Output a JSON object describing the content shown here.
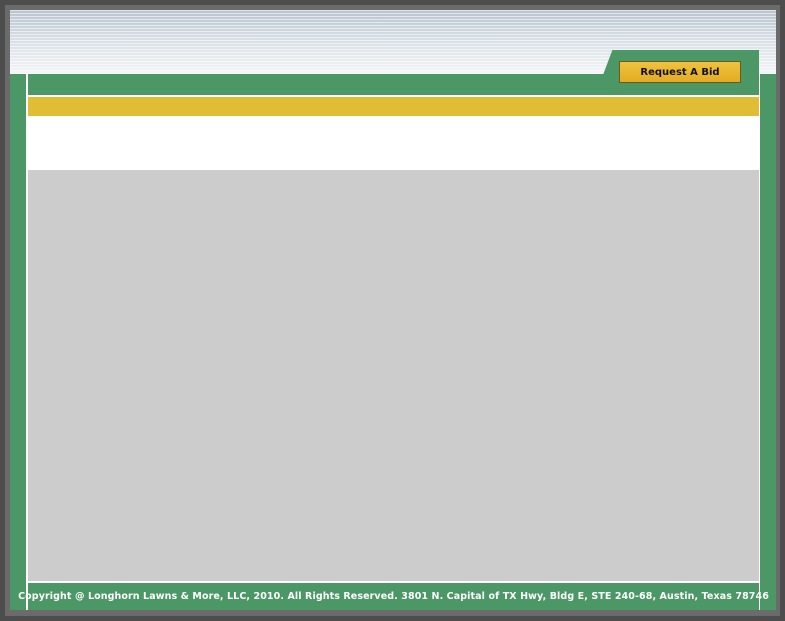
{
  "header": {
    "request_bid_label": "Request A Bid"
  },
  "footer": {
    "copyright": "Copyright @ Longhorn Lawns & More, LLC, 2010. All Rights Reserved. 3801 N. Capital of TX Hwy, Bldg E, STE 240-68, Austin, Texas 78746"
  },
  "colors": {
    "brand_green": "#4c9766",
    "accent_gold": "#e1bd36",
    "content_gray": "#cccccc"
  }
}
